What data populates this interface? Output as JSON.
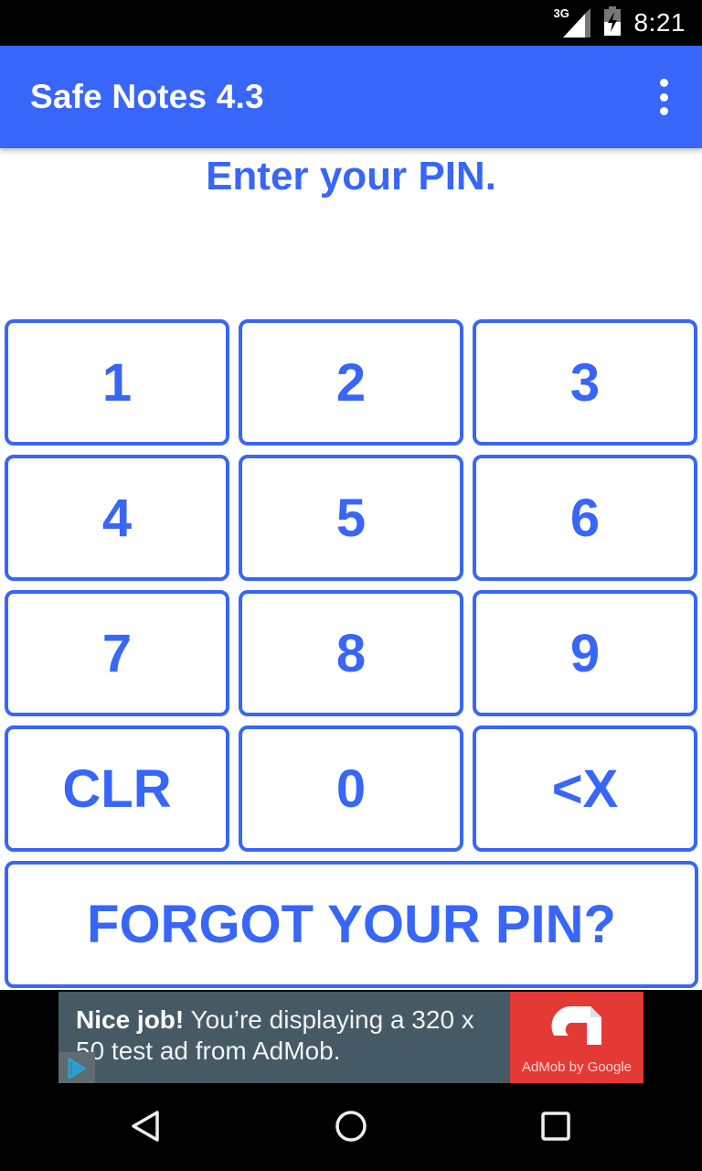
{
  "status_bar": {
    "network": "3G",
    "time": "8:21",
    "icons": [
      "signal-icon",
      "battery-charging-icon"
    ]
  },
  "app_bar": {
    "title": "Safe Notes 4.3",
    "menu_icon": "overflow-menu-icon"
  },
  "prompt": "Enter your PIN.",
  "keypad": {
    "keys": [
      {
        "label": "1",
        "name": "key-1"
      },
      {
        "label": "2",
        "name": "key-2"
      },
      {
        "label": "3",
        "name": "key-3"
      },
      {
        "label": "4",
        "name": "key-4"
      },
      {
        "label": "5",
        "name": "key-5"
      },
      {
        "label": "6",
        "name": "key-6"
      },
      {
        "label": "7",
        "name": "key-7"
      },
      {
        "label": "8",
        "name": "key-8"
      },
      {
        "label": "9",
        "name": "key-9"
      },
      {
        "label": "CLR",
        "name": "clear-button"
      },
      {
        "label": "0",
        "name": "key-0"
      },
      {
        "label": "<X",
        "name": "backspace-button"
      }
    ],
    "forgot_label": "FORGOT YOUR PIN?"
  },
  "ad": {
    "headline": "Nice job!",
    "body": " You’re displaying a 320 x 50 test ad from AdMob.",
    "logo_text": "AdMob by Google",
    "colors": {
      "body": "#455a64",
      "logo": "#e53935"
    }
  },
  "nav_bar": {
    "buttons": [
      "back-icon",
      "home-icon",
      "recents-icon"
    ]
  },
  "colors": {
    "accent": "#3766f8",
    "status_bar": "#000000"
  }
}
